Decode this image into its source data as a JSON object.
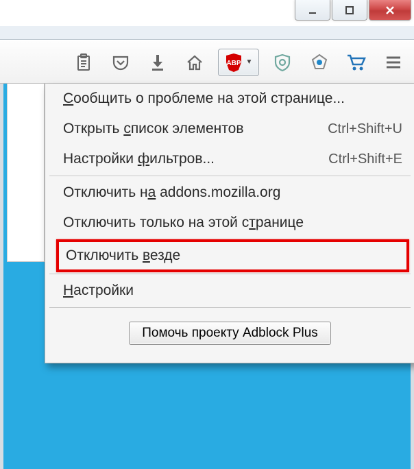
{
  "window_controls": {
    "minimize": "minimize",
    "maximize": "maximize",
    "close": "close"
  },
  "toolbar": {
    "items": [
      "clipboard-icon",
      "pocket-icon",
      "download-icon",
      "home-icon",
      "abp-icon",
      "privacy-icon",
      "eye-icon",
      "cart-icon",
      "menu-icon"
    ]
  },
  "abp": {
    "label": "ABP"
  },
  "menu": {
    "items": [
      {
        "pre": "",
        "u": "С",
        "post": "ообщить о проблеме на этой странице...",
        "shortcut": ""
      },
      {
        "pre": "Открыть ",
        "u": "с",
        "post": "писок элементов",
        "shortcut": "Ctrl+Shift+U"
      },
      {
        "pre": "Настройки ",
        "u": "ф",
        "post": "ильтров...",
        "shortcut": "Ctrl+Shift+E"
      }
    ],
    "items2": [
      {
        "pre": "Отключить н",
        "u": "а",
        "post": " addons.mozilla.org"
      },
      {
        "pre": "Отключить только на этой с",
        "u": "т",
        "post": "ранице"
      },
      {
        "pre": "Отключить ",
        "u": "в",
        "post": "езде"
      }
    ],
    "items3": [
      {
        "pre": "",
        "u": "Н",
        "post": "астройки"
      }
    ],
    "help_button": "Помочь проекту Adblock Plus"
  }
}
